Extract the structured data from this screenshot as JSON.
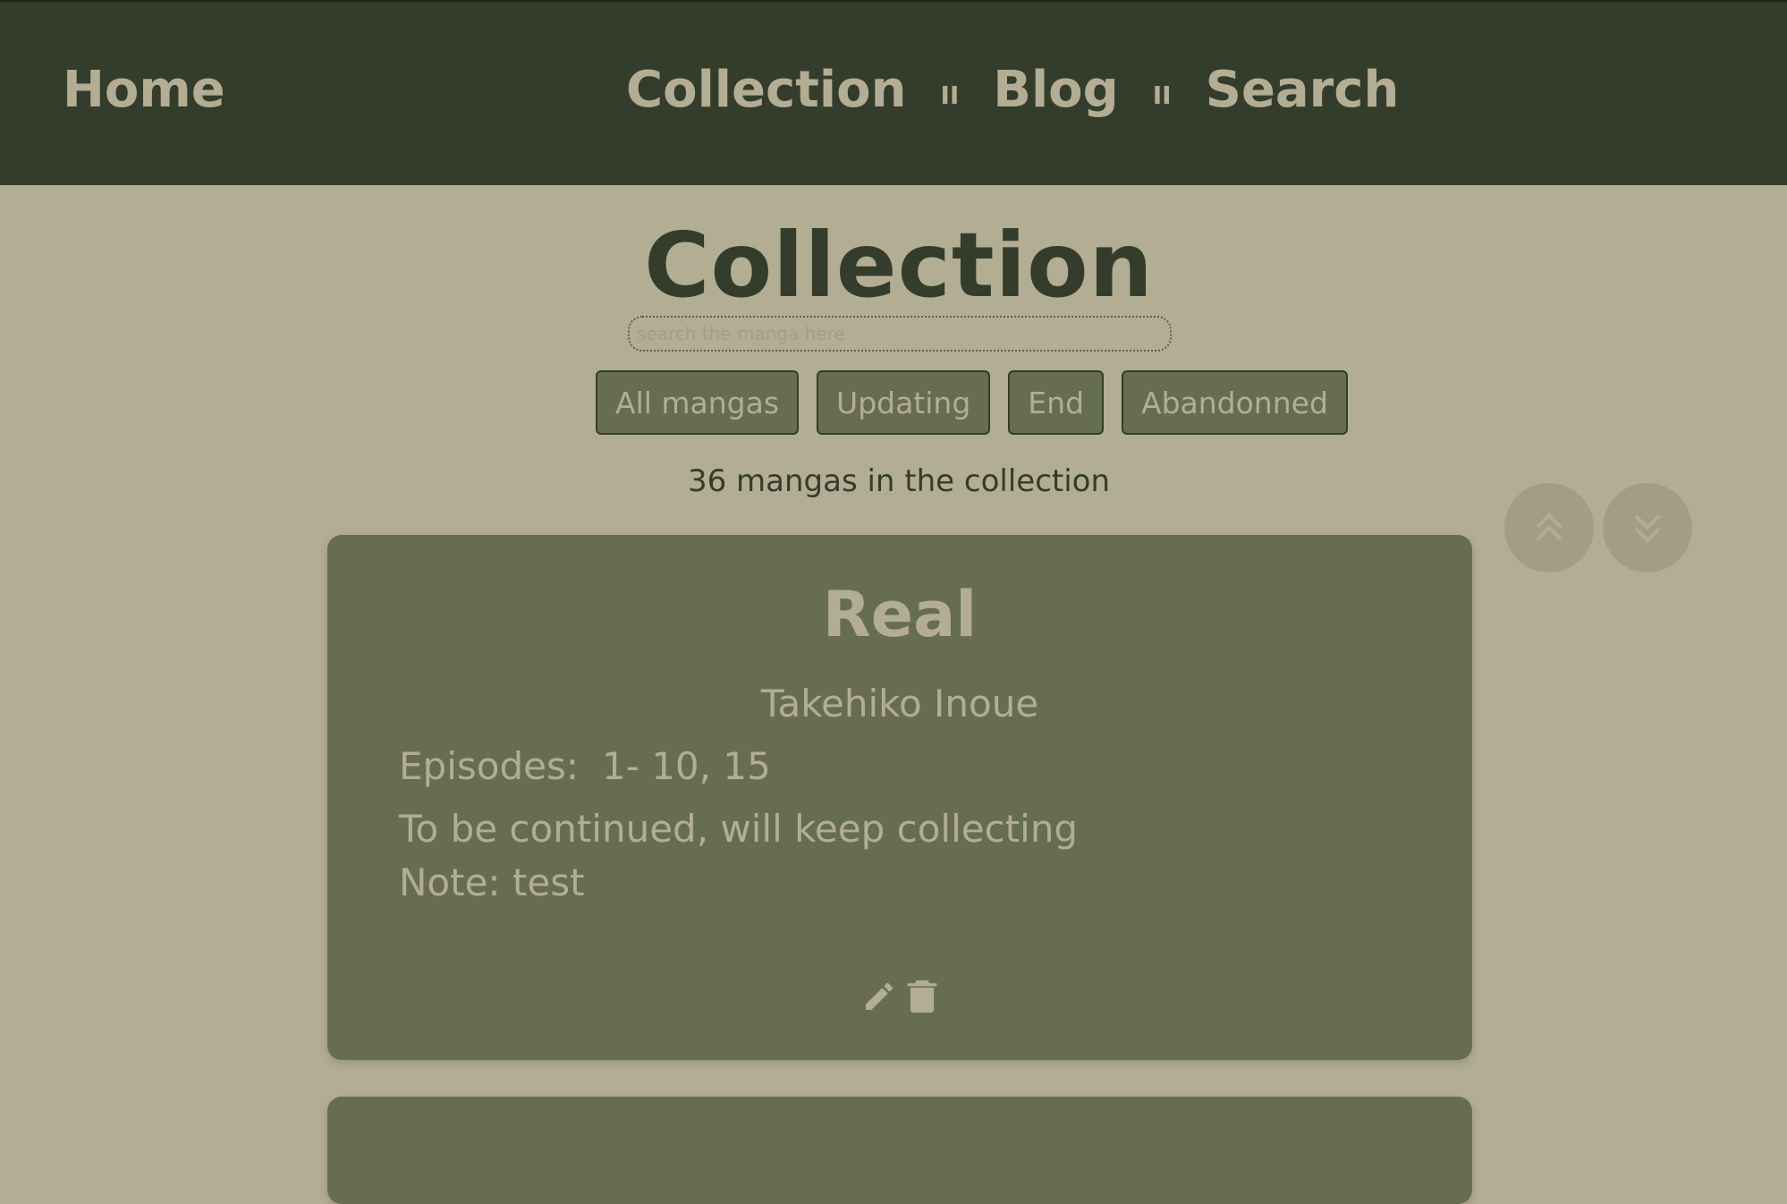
{
  "nav": {
    "home": "Home",
    "links": [
      "Collection",
      "Blog",
      "Search"
    ],
    "separator": "II"
  },
  "page": {
    "title": "Collection",
    "search_placeholder": "search the manga here",
    "filters": [
      "All mangas",
      "Updating",
      "End",
      "Abandonned"
    ],
    "count_text": "36 mangas in the collection"
  },
  "scroll_buttons": {
    "up_icon": "double-chevron-up-icon",
    "down_icon": "double-chevron-down-icon"
  },
  "mangas": [
    {
      "title": "Real",
      "author": "Takehiko Inoue",
      "episodes_label": "Episodes:",
      "episodes_value": "1- 10, 15",
      "status": "To be continued, will keep collecting",
      "note": "Note: test",
      "edit_icon": "pencil-icon",
      "delete_icon": "trash-icon"
    }
  ],
  "colors": {
    "header_bg": "#343d2b",
    "page_bg": "#b3ad94",
    "card_bg": "#676e50",
    "scroll_btn_bg": "#a29d83"
  }
}
